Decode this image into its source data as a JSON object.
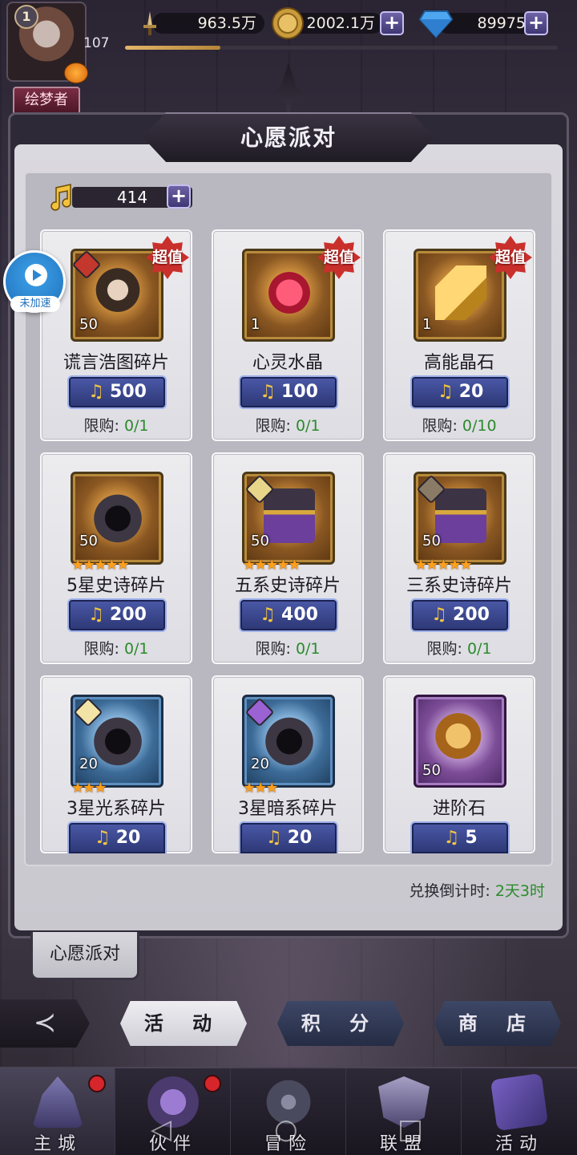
{
  "topbar": {
    "level": "1",
    "exp": "107",
    "power": "963.5万",
    "gold": "2002.1万",
    "diamond": "89975",
    "title_badge": "绘梦者"
  },
  "panel": {
    "title": "心愿派对",
    "currency": "414",
    "countdown_label": "兑换倒计时:",
    "countdown_value": "2天3时",
    "bookmark": "心愿派对"
  },
  "items": [
    {
      "name": "谎言浩图碎片",
      "count": "50",
      "price": "500",
      "limit_label": "限购:",
      "limit": "0/1",
      "super": "超值"
    },
    {
      "name": "心灵水晶",
      "count": "1",
      "price": "100",
      "limit_label": "限购:",
      "limit": "0/1",
      "super": "超值"
    },
    {
      "name": "高能晶石",
      "count": "1",
      "price": "20",
      "limit_label": "限购:",
      "limit": "0/10",
      "super": "超值"
    },
    {
      "name": "5星史诗碎片",
      "count": "50",
      "price": "200",
      "limit_label": "限购:",
      "limit": "0/1",
      "stars": "★★★★★"
    },
    {
      "name": "五系史诗碎片",
      "count": "50",
      "price": "400",
      "limit_label": "限购:",
      "limit": "0/1",
      "stars": "★★★★★"
    },
    {
      "name": "三系史诗碎片",
      "count": "50",
      "price": "200",
      "limit_label": "限购:",
      "limit": "0/1",
      "stars": "★★★★★"
    },
    {
      "name": "3星光系碎片",
      "count": "20",
      "price": "20",
      "stars": "★★★"
    },
    {
      "name": "3星暗系碎片",
      "count": "20",
      "price": "20",
      "stars": "★★★"
    },
    {
      "name": "进阶石",
      "count": "50",
      "price": "5"
    }
  ],
  "subtabs": {
    "activity": "活 动",
    "points": "积 分",
    "shop": "商 店"
  },
  "nav": {
    "main_city": "主城",
    "partner": "伙伴",
    "adventure": "冒险",
    "league": "联盟",
    "event": "活动"
  },
  "float": {
    "label": "未加速"
  },
  "colors": {
    "accent_green": "#2c8a2c",
    "price_blue": "#2c3774",
    "super_red": "#c9302c"
  }
}
